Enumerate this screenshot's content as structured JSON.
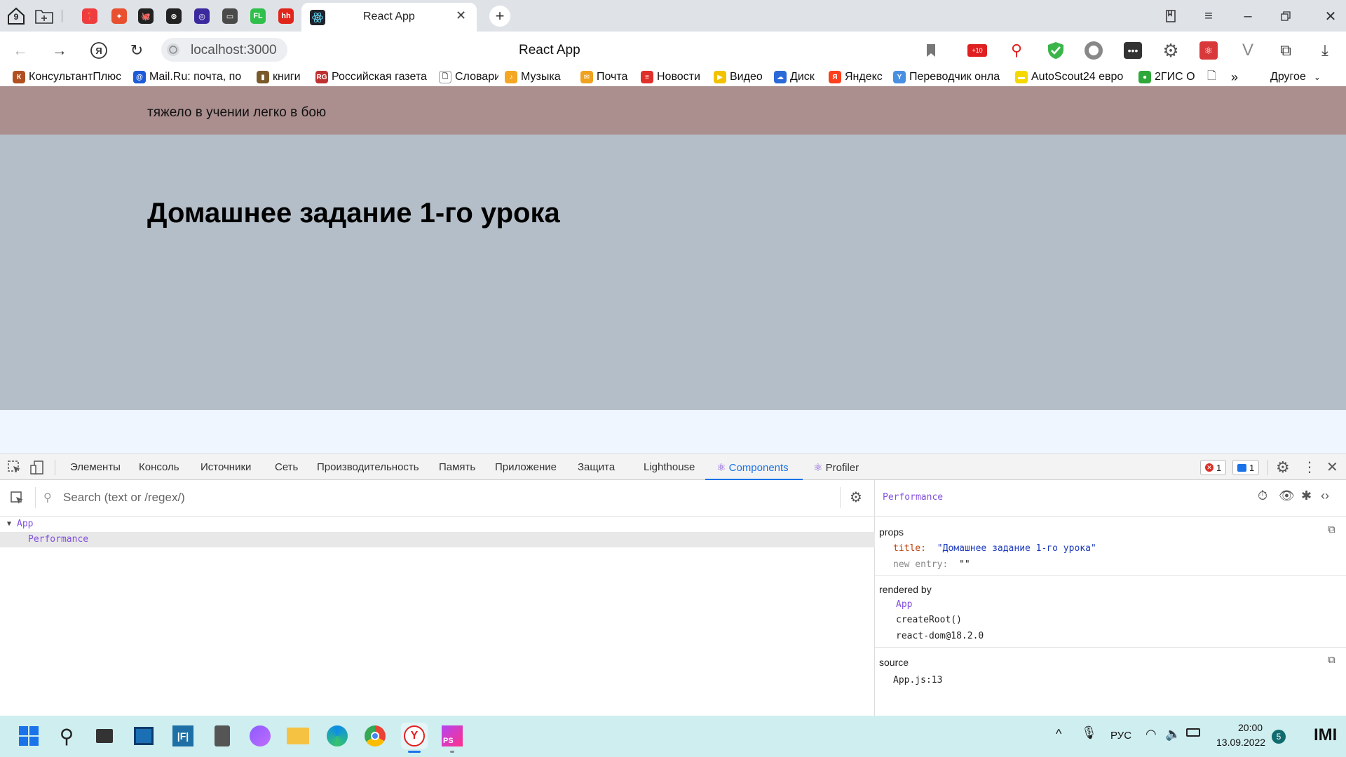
{
  "tabstrip": {
    "tab_count_badge": "9",
    "active_tab_title": "React App",
    "pinned_favicons": [
      {
        "name": "maps-icon",
        "color": "#ef3d3d",
        "glyph": "📍"
      },
      {
        "name": "habr-icon",
        "color": "#e8502f",
        "glyph": "✦"
      },
      {
        "name": "github-icon",
        "color": "#222222",
        "glyph": "🐙"
      },
      {
        "name": "openai-icon",
        "color": "#222222",
        "glyph": "⊛"
      },
      {
        "name": "space-icon",
        "color": "#3b2a9e",
        "glyph": "◎"
      },
      {
        "name": "terminal-icon",
        "color": "#4a4a4a",
        "glyph": "▭"
      },
      {
        "name": "fl-icon",
        "color": "#2fbf4a",
        "glyph": "FL"
      },
      {
        "name": "hh-icon",
        "color": "#e0261b",
        "glyph": "hh"
      }
    ]
  },
  "toolbar": {
    "address": "localhost:3000",
    "page_title": "React App"
  },
  "bookmarks": [
    {
      "label": "КонсультантПлюс",
      "color": "#b05020",
      "glyph": "К"
    },
    {
      "label": "Mail.Ru: почта, по",
      "color": "#1d5bd8",
      "glyph": "@"
    },
    {
      "label": "книги",
      "color": "#7a5a2a",
      "glyph": "▮"
    },
    {
      "label": "Российская газета",
      "color": "#c03030",
      "glyph": "RG"
    },
    {
      "label": "Словари",
      "color": "#ffffff",
      "glyph": "🗋"
    },
    {
      "label": "Музыка",
      "color": "#f5a623",
      "glyph": "♪"
    },
    {
      "label": "Почта",
      "color": "#f0a21f",
      "glyph": "✉"
    },
    {
      "label": "Новости",
      "color": "#e0302a",
      "glyph": "≡"
    },
    {
      "label": "Видео",
      "color": "#f2c200",
      "glyph": "▶"
    },
    {
      "label": "Диск",
      "color": "#2a6ad8",
      "glyph": "☁"
    },
    {
      "label": "Яндекс",
      "color": "#fc3f1d",
      "glyph": "Я"
    },
    {
      "label": "Переводчик онла",
      "color": "#4a90e2",
      "glyph": "Y"
    },
    {
      "label": "AutoScout24 евро",
      "color": "#f5d800",
      "glyph": "▬"
    },
    {
      "label": "2ГИС О",
      "color": "#2fa83a",
      "glyph": "●"
    }
  ],
  "bookmarks_other": "Другое",
  "page": {
    "slogan": "тяжело в учении легко в бою",
    "heading": "Домашнее задание 1-го урока"
  },
  "devtools": {
    "tabs": [
      "Элементы",
      "Консоль",
      "Источники",
      "Сеть",
      "Производительность",
      "Память",
      "Приложение",
      "Защита",
      "Lighthouse",
      "Components",
      "Profiler"
    ],
    "active_tab": "Components",
    "errors_count": "1",
    "messages_count": "1",
    "search_placeholder": "Search (text or /regex/)",
    "tree": {
      "root": "App",
      "child": "Performance"
    },
    "inspector": {
      "component_name": "Performance",
      "props_label": "props",
      "props": [
        {
          "key": "title",
          "value": "\"Домашнее задание 1-го урока\""
        },
        {
          "key": "new entry",
          "value": "\"\""
        }
      ],
      "rendered_by_label": "rendered by",
      "rendered_by": [
        "App",
        "createRoot()",
        "react-dom@18.2.0"
      ],
      "source_label": "source",
      "source": "App.js:13"
    }
  },
  "taskbar": {
    "language": "РУС",
    "time": "20:00",
    "date": "13.09.2022",
    "notifications": "5"
  }
}
